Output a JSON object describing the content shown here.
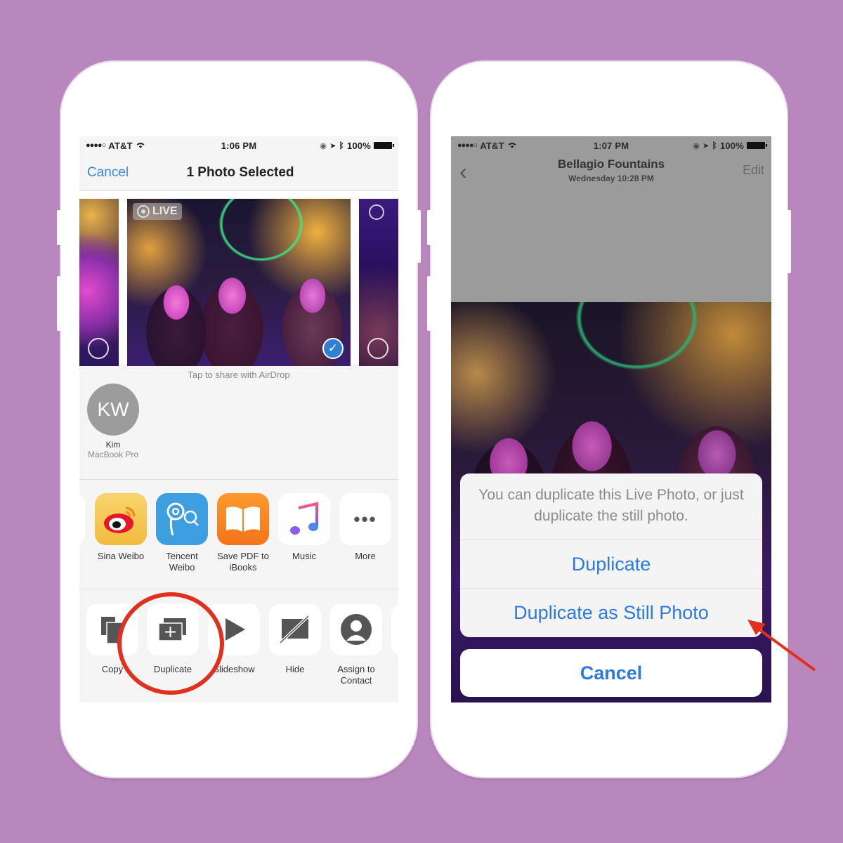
{
  "left_phone": {
    "status": {
      "carrier": "AT&T",
      "signal": "●●●●○",
      "time": "1:06 PM",
      "battery": "100%"
    },
    "nav": {
      "cancel": "Cancel",
      "title": "1 Photo Selected"
    },
    "carousel": {
      "live_badge": "LIVE",
      "selected_check": "✓"
    },
    "airdrop": {
      "hint": "Tap to share with AirDrop",
      "contact": {
        "initials": "KW",
        "name": "Kim",
        "device": "MacBook Pro"
      }
    },
    "apps": [
      {
        "label": "Sina Weibo",
        "icon": "sina-weibo-icon"
      },
      {
        "label": "Tencent Weibo",
        "icon": "tencent-weibo-icon"
      },
      {
        "label": "Save PDF to iBooks",
        "icon": "ibooks-icon"
      },
      {
        "label": "Music",
        "icon": "music-icon"
      },
      {
        "label": "More",
        "icon": "more-icon",
        "glyph": "•••"
      }
    ],
    "actions": [
      {
        "label": "Copy",
        "icon": "copy-icon"
      },
      {
        "label": "Duplicate",
        "icon": "duplicate-icon"
      },
      {
        "label": "Slideshow",
        "icon": "slideshow-icon"
      },
      {
        "label": "Hide",
        "icon": "hide-icon"
      },
      {
        "label": "Assign to Contact",
        "icon": "assign-contact-icon"
      }
    ]
  },
  "right_phone": {
    "status": {
      "carrier": "AT&T",
      "signal": "●●●●○",
      "time": "1:07 PM",
      "battery": "100%"
    },
    "nav": {
      "back": "‹",
      "title": "Bellagio Fountains",
      "subtitle": "Wednesday  10:28 PM",
      "edit": "Edit"
    },
    "sheet": {
      "message": "You can duplicate this Live Photo, or just duplicate the still photo.",
      "buttons": [
        "Duplicate",
        "Duplicate as Still Photo"
      ],
      "cancel": "Cancel"
    }
  },
  "colors": {
    "background": "#b887bd",
    "ios_blue": "#2c7ae0",
    "annotation_red": "#e0301e"
  }
}
